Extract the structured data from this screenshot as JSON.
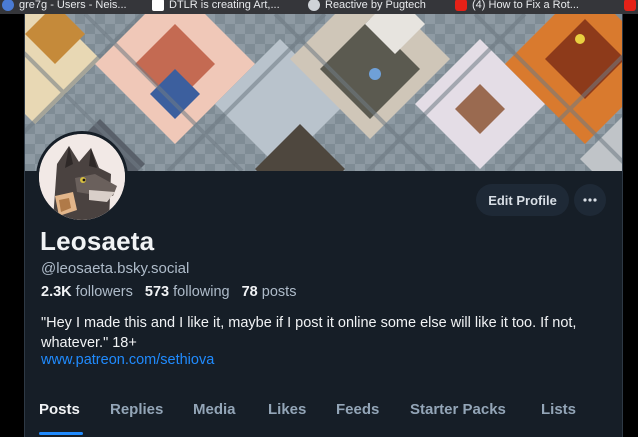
{
  "bookmarks": [
    {
      "label": "gre7g - Users - Neis...",
      "color": "#4a7bd4"
    },
    {
      "label": "DTLR is creating Art,...",
      "color": "#ffffff"
    },
    {
      "label": "Reactive by Pugtech",
      "color": "#cfd3d8"
    },
    {
      "label": "(4) How to Fix a Rot...",
      "color": "#e62117"
    },
    {
      "label": "",
      "color": "#e62117"
    }
  ],
  "profile": {
    "display_name": "Leosaeta",
    "handle": "@leosaeta.bsky.social",
    "followers_count": "2.3K",
    "followers_label": "followers",
    "following_count": "573",
    "following_label": "following",
    "posts_count": "78",
    "posts_label": "posts",
    "bio": "\"Hey I made this and I like it, maybe if I post it online some else will like it too. If not, whatever.\" 18+",
    "link": "www.patreon.com/sethiova"
  },
  "actions": {
    "edit_profile": "Edit Profile",
    "more": "···"
  },
  "tabs": [
    {
      "label": "Posts",
      "active": true
    },
    {
      "label": "Replies",
      "active": false
    },
    {
      "label": "Media",
      "active": false
    },
    {
      "label": "Likes",
      "active": false
    },
    {
      "label": "Feeds",
      "active": false
    },
    {
      "label": "Starter Packs",
      "active": false
    },
    {
      "label": "Lists",
      "active": false
    }
  ],
  "colors": {
    "background": "#161e27",
    "accent": "#208bfe",
    "muted_text": "#aebbc9"
  }
}
